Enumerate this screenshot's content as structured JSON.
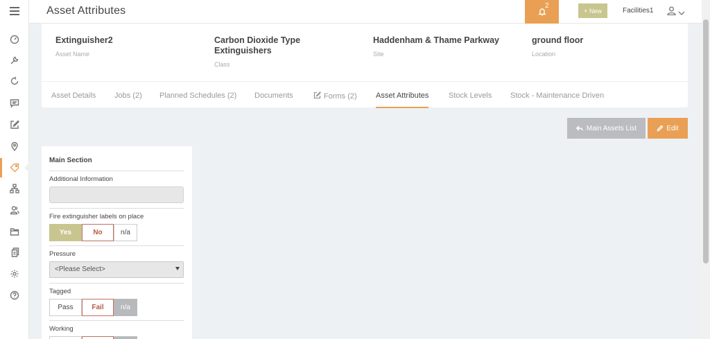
{
  "topbar": {
    "title": "Asset Attributes",
    "notification_count": "2",
    "new_button": "+ New",
    "user_name": "Facilities1"
  },
  "asset": {
    "name": "Extinguisher2",
    "name_label": "Asset Name",
    "class": "Carbon Dioxide Type Extinguishers",
    "class_label": "Class",
    "site": "Haddenham & Thame Parkway",
    "site_label": "Site",
    "location": "ground floor",
    "location_label": "Location"
  },
  "tabs": [
    {
      "label": "Asset Details"
    },
    {
      "label": "Jobs (2)"
    },
    {
      "label": "Planned Schedules (2)"
    },
    {
      "label": "Documents"
    },
    {
      "label": "Forms (2)"
    },
    {
      "label": "Asset Attributes"
    },
    {
      "label": "Stock Levels"
    },
    {
      "label": "Stock - Maintenance Driven"
    }
  ],
  "active_tab": "Asset Attributes",
  "actions": {
    "main_assets_list": "Main Assets List",
    "edit": "Edit"
  },
  "form": {
    "section_title": "Main Section",
    "additional_info": {
      "label": "Additional Information",
      "value": ""
    },
    "labels_on_place": {
      "label": "Fire extinguisher labels on place",
      "options": [
        "Yes",
        "No",
        "n/a"
      ],
      "selected": "Yes"
    },
    "pressure": {
      "label": "Pressure",
      "value": "<Please Select>"
    },
    "tagged": {
      "label": "Tagged",
      "options": [
        "Pass",
        "Fail",
        "n/a"
      ],
      "selected": "n/a"
    },
    "working": {
      "label": "Working"
    }
  },
  "sidebar": {
    "items": [
      {
        "icon": "dashboard-icon"
      },
      {
        "icon": "wrench-icon"
      },
      {
        "icon": "refresh-icon"
      },
      {
        "icon": "chat-icon"
      },
      {
        "icon": "edit-icon"
      },
      {
        "icon": "location-pin-icon"
      },
      {
        "icon": "tag-icon",
        "active": true
      },
      {
        "icon": "hierarchy-icon"
      },
      {
        "icon": "contacts-icon"
      },
      {
        "icon": "folder-icon"
      },
      {
        "icon": "documents-icon"
      },
      {
        "icon": "gear-icon"
      },
      {
        "icon": "help-icon"
      }
    ]
  },
  "colors": {
    "accent": "#e9a055",
    "olive": "#c8c58f",
    "grey_button": "#babcbf",
    "background": "#eef1f4"
  }
}
